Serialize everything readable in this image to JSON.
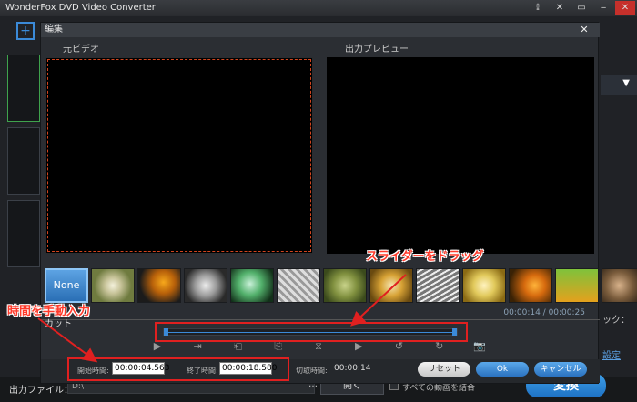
{
  "app": {
    "title": "WonderFox DVD Video Converter",
    "window_icons": [
      "upload-icon",
      "wrench-icon",
      "chat-icon",
      "minimize-icon",
      "close-icon"
    ],
    "window_icon_glyphs": [
      "⇪",
      "✕",
      "▭",
      "‒",
      "✕"
    ]
  },
  "sidebar": {
    "add_glyph": "+"
  },
  "right_panel": {
    "dropdown_glyph": "▼",
    "check_label": "ック：",
    "settings_link": "設定"
  },
  "bottom": {
    "output_label": "出力ファイル：",
    "output_path": "D:\\",
    "browse_glyph": "…",
    "open_button": "開く",
    "merge_label": "すべての動画を結合",
    "convert_button": "変換"
  },
  "dialog": {
    "title": "編集",
    "close_glyph": "✕",
    "source_label": "元ビデオ",
    "preview_label": "出力プレビュー",
    "filters": [
      {
        "name": "None"
      },
      {
        "name": ""
      },
      {
        "name": ""
      },
      {
        "name": ""
      },
      {
        "name": ""
      },
      {
        "name": ""
      },
      {
        "name": ""
      },
      {
        "name": ""
      },
      {
        "name": ""
      },
      {
        "name": ""
      },
      {
        "name": ""
      },
      {
        "name": ""
      },
      {
        "name": ""
      }
    ],
    "cut_label": "カット",
    "timecode": "00:00:14 / 00:00:25",
    "slider": {
      "start_fraction": 0.0,
      "end_fraction": 1.0
    },
    "controls": [
      {
        "icon": "play-icon",
        "glyph": "▶"
      },
      {
        "icon": "set-start-icon",
        "glyph": "⇥"
      },
      {
        "icon": "clip-start-icon",
        "glyph": "⎗"
      },
      {
        "icon": "clip-end-icon",
        "glyph": "⎘"
      },
      {
        "icon": "split-icon",
        "glyph": "⧖"
      },
      {
        "icon": "play-selection-icon",
        "glyph": "▶"
      },
      {
        "icon": "rotate-left-icon",
        "glyph": "↺"
      },
      {
        "icon": "rotate-right-icon",
        "glyph": "↻"
      },
      {
        "icon": "snapshot-icon",
        "glyph": "📷"
      }
    ],
    "start_label": "開始時間:",
    "start_value": "00:00:04.563",
    "end_label": "終了時間:",
    "end_value": "00:00:18.580",
    "cut_time_label": "切取時間:",
    "cut_time_value": "00:00:14",
    "reset_button": "リセット",
    "ok_button": "Ok",
    "cancel_button": "キャンセル"
  },
  "annotations": {
    "slider_note": "スライダーをドラッグ",
    "time_note": "時間を手動入力",
    "color": "#e02020"
  }
}
